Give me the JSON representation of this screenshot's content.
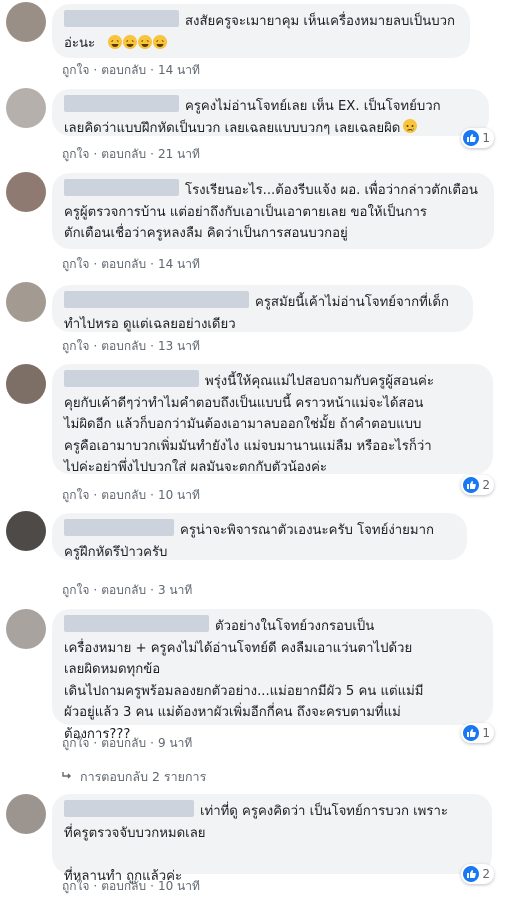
{
  "ui": {
    "like": "ถูกใจ",
    "reply": "ตอบกลับ",
    "sep": "·"
  },
  "comments": [
    {
      "text": "สงสัยครูจะเมายาคุม เห็นเครื่องหมายลบเป็นบวก\nอ่ะนะ",
      "emoji": "laughing-emoji x4",
      "time": "14 นาที"
    },
    {
      "text": "ครูคงไม่อ่านโจทย์เลย เห็น EX. เป็นโจทย์บวก\nเลยคิดว่าแบบฝึกหัดเป็นบวก เลยเฉลยแบบบวกๆ เลยเฉลยผิด",
      "emoji": "sad-emoji",
      "time": "21 นาที",
      "reactions": "1"
    },
    {
      "text": "โรงเรียนอะไร...ต้องรีบแจ้ง ผอ. เพื่อว่ากล่าวตักเตือน\nครูผู้ตรวจการบ้าน แต่อย่าถึงกับเอาเป็นเอาตายเลย ขอให้เป็นการ\nตักเตือนเชื่อว่าครูหลงลืม คิดว่าเป็นการสอนบวกอยู่",
      "time": "14 นาที"
    },
    {
      "text": "ครูสมัยนี้เค้าไม่อ่านโจทย์จากที่เด็ก\nทำไปหรอ ดูแต่เฉลยอย่างเดียว",
      "time": "13 นาที"
    },
    {
      "text": "พรุ่งนี้ให้คุณแม่ไปสอบถามกับครูผู้สอนค่ะ\nคุยกับเค้าดีๆว่าทำไมคำตอบถึงเป็นแบบนี้ คราวหน้าแม่จะได้สอน\nไม่ผิดอีก แล้วก็บอกว่ามันต้องเอามาลบออกใช่มั้ย ถ้าคำตอบแบบ\nครูคือเอามาบวกเพิ่มมันทำยังไง แม่จบมานานแม่ลืม หรืออะไรก็ว่า\nไปค่ะอย่าพึ่งไปบวกใส่ ผลมันจะตกกับตัวน้องค่ะ",
      "time": "10 นาที",
      "reactions": "2"
    },
    {
      "text": "ครูน่าจะพิจารณาตัวเองนะครับ โจทย์ง่ายมาก\nครูฝึกหัดรึป่าวครับ",
      "time": "3 นาที"
    },
    {
      "text": "ตัวอย่างในโจทย์วงกรอบเป็น\nเครื่องหมาย + ครูคงไม่ได้อ่านโจทย์ดี คงลืมเอาแว่นตาไปด้วย\nเลยผิดหมดทุกข้อ\nเดินไปถามครูพร้อมลองยกตัวอย่าง...แม่อยากมีผัว 5 คน แต่แม่มี\nผัวอยู่แล้ว 3 คน แม่ต้องหาผัวเพิ่มอีกกี่คน ถึงจะครบตามที่แม่\nต้องการ???",
      "time": "9 นาที",
      "reactions": "1",
      "replies": "การตอบกลับ 2 รายการ"
    },
    {
      "text": "เท่าที่ดู ครูคงคิดว่า เป็นโจทย์การบวก เพราะ\nที่ครูตรวจจับบวกหมดเลย\n\nที่หลานทำ ถูกแล้วค่ะ",
      "time": "10 นาที",
      "reactions": "2"
    }
  ]
}
